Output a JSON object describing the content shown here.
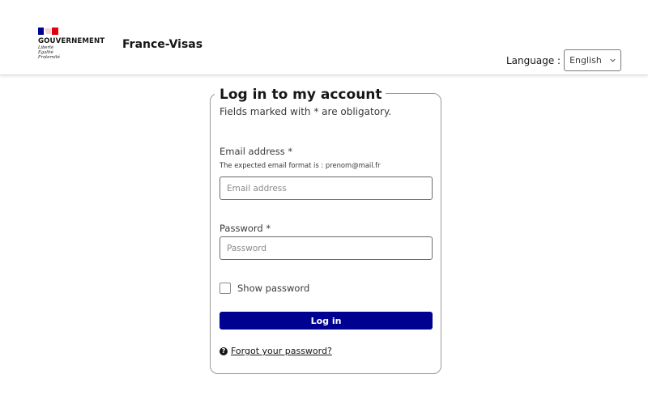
{
  "header": {
    "gov_title": "GOUVERNEMENT",
    "motto": [
      "Liberté",
      "Égalité",
      "Fraternité"
    ],
    "site_name": "France-Visas",
    "language_label": "Language :",
    "language_selected": "English",
    "flag_colors": {
      "blue": "#000091",
      "red": "#e1000f"
    }
  },
  "login": {
    "title": "Log in to my account",
    "subtitle": "Fields marked with * are obligatory.",
    "email_label": "Email address *",
    "email_hint": "The expected email format is : prenom@mail.fr",
    "email_placeholder": "Email address",
    "email_value": "",
    "password_label": "Password *",
    "password_placeholder": "Password",
    "password_value": "",
    "show_password_label": "Show password",
    "show_password_checked": false,
    "login_button": "Log in",
    "forgot_link": "Forgot your password?",
    "help_icon_glyph": "?"
  },
  "colors": {
    "primary_button": "#000091",
    "text": "#161616",
    "border": "#9a9a9a"
  },
  "icons": {
    "language_dropdown": "chevron-down-icon",
    "forgot_password": "question-circle-icon",
    "logo": "marianne-flag-icon"
  }
}
